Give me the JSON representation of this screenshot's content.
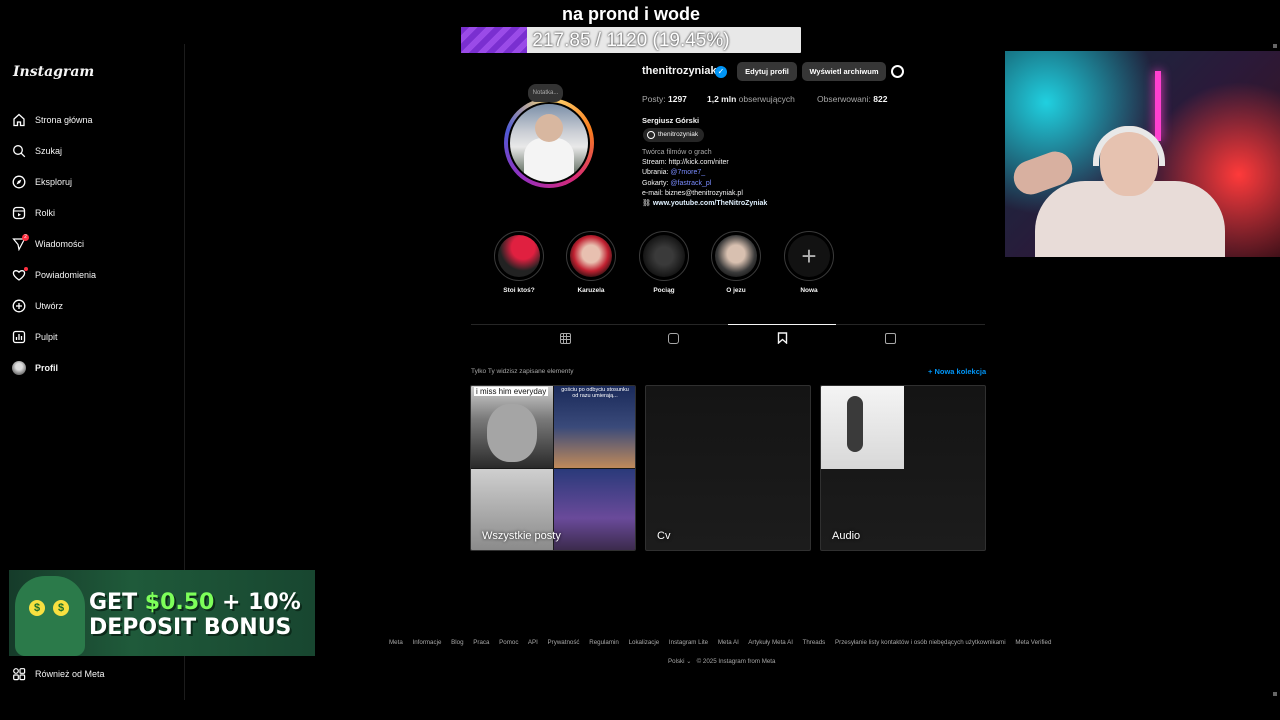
{
  "overlay": {
    "goal_title": "na prond i wode",
    "goal_text": "217.85 / 1120 (19.45%)",
    "goal_fraction": 0.1945
  },
  "sidebar": {
    "logo": "Instagram",
    "items": [
      {
        "label": "Strona główna",
        "icon": "home-icon"
      },
      {
        "label": "Szukaj",
        "icon": "search-icon"
      },
      {
        "label": "Eksploruj",
        "icon": "compass-icon"
      },
      {
        "label": "Rolki",
        "icon": "reels-icon"
      },
      {
        "label": "Wiadomości",
        "icon": "messenger-icon",
        "badge": "2"
      },
      {
        "label": "Powiadomienia",
        "icon": "heart-icon"
      },
      {
        "label": "Utwórz",
        "icon": "plus-square-icon"
      },
      {
        "label": "Pulpit",
        "icon": "dashboard-icon"
      },
      {
        "label": "Profil",
        "icon": "avatar"
      }
    ],
    "also_from_meta": "Również od Meta"
  },
  "ad": {
    "line1_prefix": "GET ",
    "line1_money": "$0.50",
    "line1_suffix": " + 10%",
    "line2": "DEPOSIT BONUS"
  },
  "profile": {
    "note": "Notatka...",
    "username": "thenitrozyniak",
    "edit_button": "Edytuj profil",
    "archive_button": "Wyświetl archiwum",
    "posts_label": "Posty:",
    "posts_count": "1297",
    "followers_count": "1,2 mln",
    "followers_label": "obserwujących",
    "following_label": "Obserwowani:",
    "following_count": "822",
    "full_name": "Sergiusz Górski",
    "threads_handle": "thenitrozyniak",
    "bio": {
      "category": "Twórca filmów o grach",
      "line_stream": "Stream: http://kick.com/niter",
      "clothes_label": "Ubrania: ",
      "clothes_link": "@7more7_",
      "gokart_label": "Gokarty: ",
      "gokart_link": "@fastrack_pl",
      "email": "e-mail: biznes@thenitrozyniak.pl",
      "website": "www.youtube.com/TheNitroZyniak"
    }
  },
  "highlights": [
    {
      "label": "Stoi ktoś?"
    },
    {
      "label": "Karuzela"
    },
    {
      "label": "Pociąg"
    },
    {
      "label": "O jezu"
    },
    {
      "label": "Nowa"
    }
  ],
  "saved": {
    "note": "Tylko Ty widzisz zapisane elementy",
    "new_collection": "+ Nowa kolekcja",
    "collections": [
      {
        "name": "Wszystkie posty",
        "caption1": "i miss him everyday",
        "caption2": "gościu po odbyciu stosunku od razu umierają..."
      },
      {
        "name": "Cv"
      },
      {
        "name": "Audio"
      }
    ]
  },
  "footer": {
    "links": [
      "Meta",
      "Informacje",
      "Blog",
      "Praca",
      "Pomoc",
      "API",
      "Prywatność",
      "Regulamin",
      "Lokalizacje",
      "Instagram Lite",
      "Meta AI",
      "Artykuły Meta AI",
      "Threads",
      "Przesyłanie listy kontaktów i osób niebędących użytkownikami",
      "Meta Verified"
    ],
    "language": "Polski",
    "copyright": "© 2025 Instagram from Meta"
  }
}
